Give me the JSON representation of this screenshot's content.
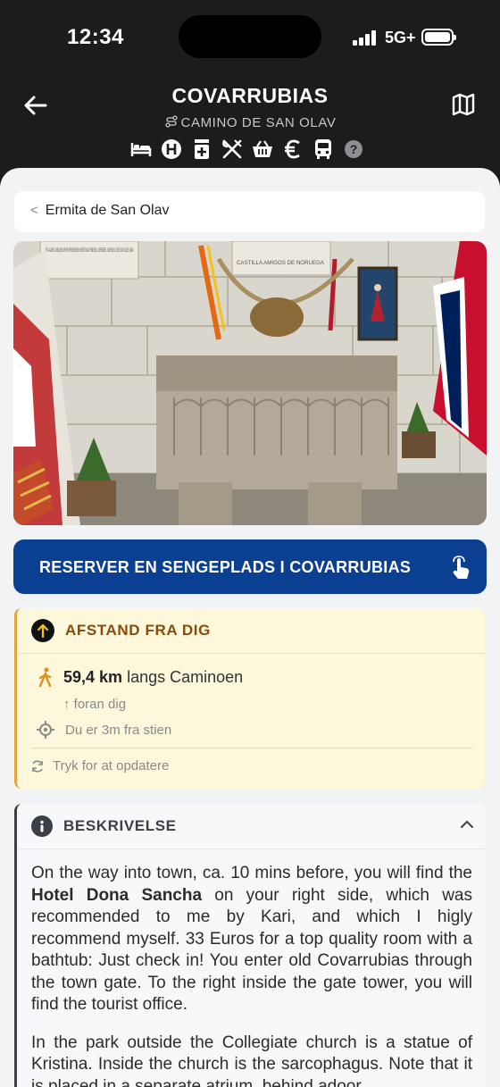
{
  "status_bar": {
    "time": "12:34",
    "network": "5G+"
  },
  "header": {
    "title": "COVARRUBIAS",
    "route": "CAMINO DE SAN OLAV",
    "services": [
      "bed-icon",
      "hotel-icon",
      "pharmacy-icon",
      "restaurant-icon",
      "shop-icon",
      "atm-euro-icon",
      "bus-icon",
      "help-icon"
    ]
  },
  "breadcrumb": {
    "label": "Ermita de San Olav"
  },
  "cta": {
    "label": "RESERVER EN SENGEPLADS I COVARRUBIAS"
  },
  "distance": {
    "title": "AFSTAND FRA DIG",
    "km": "59,4 km",
    "along": "langs Caminoen",
    "direction": "↑ foran dig",
    "offtrail": "Du er 3m fra stien",
    "refresh": "Tryk for at opdatere"
  },
  "description": {
    "title": "BESKRIVELSE",
    "p1_a": "On the way into town, ca. 10 mins before, you will find the ",
    "p1_bold": "Hotel Dona Sancha",
    "p1_b": " on your right side, which was recommended to me by Kari, and which I higly recommend myself. 33 Euros for a top quality room with a bathtub: Just check in! You enter old Covarrubias through the town gate. To the right inside the gate tower, you will find the tourist office.",
    "p2": "In the park outside the Collegiate church is a statue of Kristina. Inside the church is the sarcophagus. Note that it is placed in a separate atrium, behind adoor."
  },
  "photo": {
    "plaque_left": "750-AARS JUBILEUM FOR PRINSESSE KRISTINAS FØDSEL I BERGEN, NORGE 13 DE MAYO DE 1984",
    "plaque_right": "CASTILLA AMIGOS DE NORUEGA"
  }
}
